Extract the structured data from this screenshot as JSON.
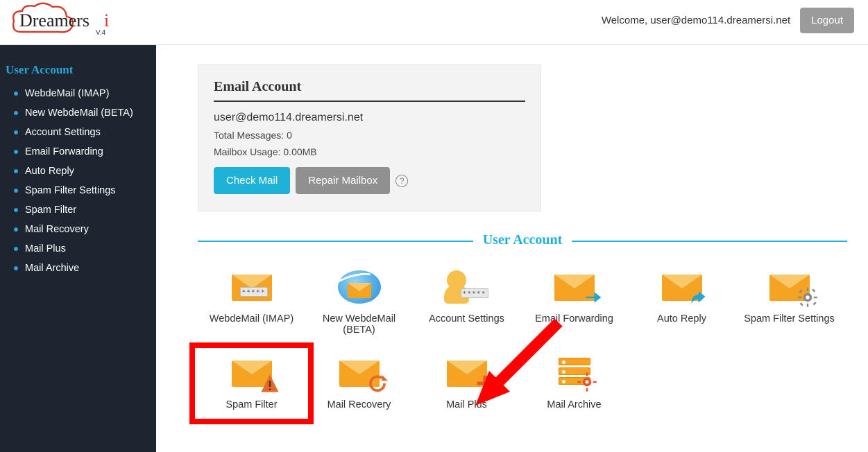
{
  "header": {
    "welcome": "Welcome, user@demo114.dreamersi.net",
    "logout": "Logout",
    "brand": "Dreamersi",
    "brand_version": "V.4"
  },
  "sidebar": {
    "title": "User Account",
    "items": [
      {
        "label": "WebdeMail (IMAP)"
      },
      {
        "label": "New WebdeMail (BETA)"
      },
      {
        "label": "Account Settings"
      },
      {
        "label": "Email Forwarding"
      },
      {
        "label": "Auto Reply"
      },
      {
        "label": "Spam Filter Settings"
      },
      {
        "label": "Spam Filter"
      },
      {
        "label": "Mail Recovery"
      },
      {
        "label": "Mail Plus"
      },
      {
        "label": "Mail Archive"
      }
    ]
  },
  "card": {
    "title": "Email Account",
    "email": "user@demo114.dreamersi.net",
    "total_messages_label": "Total Messages:",
    "total_messages_value": "0",
    "mailbox_usage_label": "Mailbox Usage:",
    "mailbox_usage_value": "0.00MB",
    "check_mail": "Check Mail",
    "repair_mailbox": "Repair Mailbox",
    "help_glyph": "?"
  },
  "section": {
    "title": "User Account"
  },
  "tiles": [
    {
      "label": "WebdeMail (IMAP)",
      "icon": "envelope-password"
    },
    {
      "label": "New WebdeMail (BETA)",
      "icon": "envelope-globe"
    },
    {
      "label": "Account Settings",
      "icon": "person-password"
    },
    {
      "label": "Email Forwarding",
      "icon": "envelope-forward"
    },
    {
      "label": "Auto Reply",
      "icon": "envelope-reply"
    },
    {
      "label": "Spam Filter Settings",
      "icon": "envelope-gear"
    },
    {
      "label": "Spam Filter",
      "icon": "envelope-warn",
      "highlight": true
    },
    {
      "label": "Mail Recovery",
      "icon": "envelope-undo"
    },
    {
      "label": "Mail Plus",
      "icon": "envelope-plus"
    },
    {
      "label": "Mail Archive",
      "icon": "server-gear"
    }
  ]
}
